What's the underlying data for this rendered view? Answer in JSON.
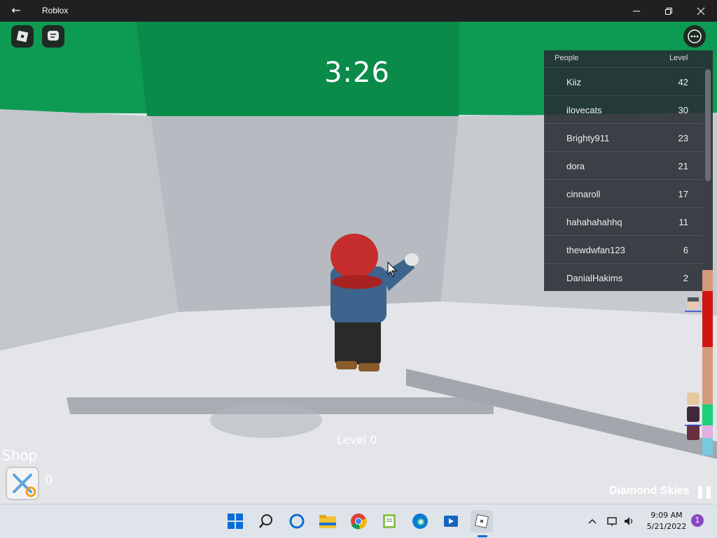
{
  "window": {
    "title": "Roblox",
    "back_icon": "back-arrow-icon",
    "controls": [
      "minimize-icon",
      "maximize-icon",
      "close-icon"
    ]
  },
  "hud": {
    "timer": "3:26",
    "level_label": "Level 0",
    "shop_label": "Shop",
    "shop_count": "0",
    "area_name": "Diamond Skies",
    "top_left_icons": [
      "roblox-menu-icon",
      "chat-icon"
    ],
    "menu_icon": "more-options-icon"
  },
  "leaderboard": {
    "header_people": "People",
    "header_level": "Level",
    "rows": [
      {
        "name": "Kiiz",
        "level": "42"
      },
      {
        "name": "ilovecats",
        "level": "30"
      },
      {
        "name": "Brighty911",
        "level": "23"
      },
      {
        "name": "dora",
        "level": "21"
      },
      {
        "name": "cinnaroll",
        "level": "17"
      },
      {
        "name": "hahahahahhq",
        "level": "11"
      },
      {
        "name": "thewdwfan123",
        "level": "6"
      },
      {
        "name": "DanialHakims",
        "level": "2"
      }
    ]
  },
  "taskbar": {
    "apps": [
      "windows-start-icon",
      "search-icon",
      "cortana-icon",
      "file-explorer-icon",
      "chrome-icon",
      "notepad-icon",
      "edge-icon",
      "media-player-icon",
      "roblox-icon"
    ],
    "time": "9:09 AM",
    "date": "5/21/2022",
    "notification_count": "1"
  },
  "colors": {
    "green_ceiling": "#0d9a53",
    "titlebar": "#202020",
    "taskbar": "#dfe4ea"
  }
}
